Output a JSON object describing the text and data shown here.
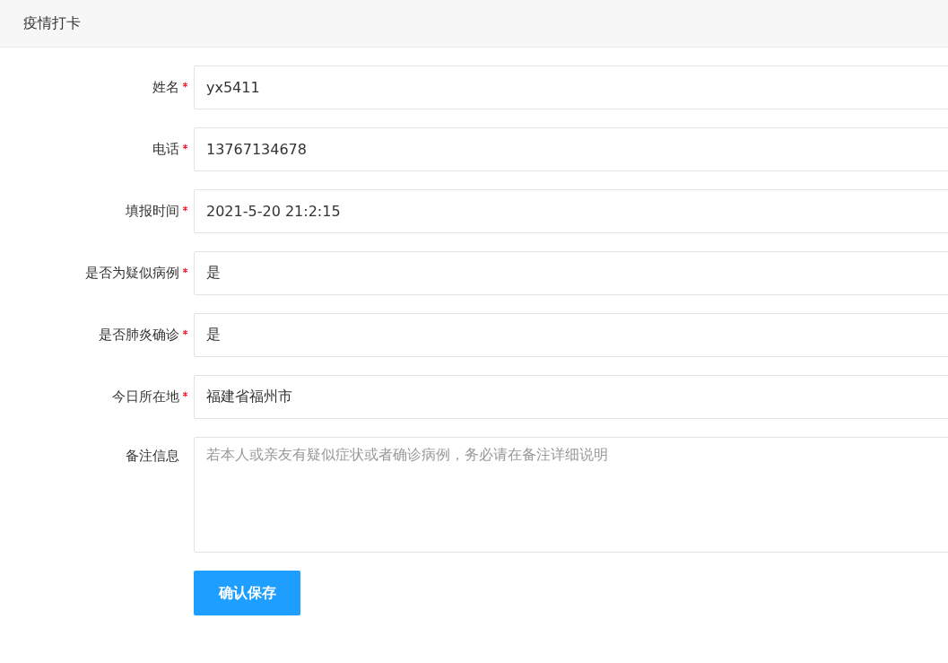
{
  "header": {
    "title": "疫情打卡"
  },
  "fields": [
    {
      "kind": "input",
      "label": "姓名",
      "required": true,
      "value": "yx5411"
    },
    {
      "kind": "input",
      "label": "电话",
      "required": true,
      "value": "13767134678"
    },
    {
      "kind": "input",
      "label": "填报时间",
      "required": true,
      "value": "2021-5-20 21:2:15"
    },
    {
      "kind": "input",
      "label": "是否为疑似病例",
      "required": true,
      "value": "是"
    },
    {
      "kind": "input",
      "label": "是否肺炎确诊",
      "required": true,
      "value": "是"
    },
    {
      "kind": "input",
      "label": "今日所在地",
      "required": true,
      "value": "福建省福州市"
    },
    {
      "kind": "textarea",
      "label": "备注信息",
      "required": false,
      "placeholder": "若本人或亲友有疑似症状或者确诊病例，务必请在备注详细说明"
    }
  ],
  "submit_button": {
    "label": "确认保存"
  }
}
